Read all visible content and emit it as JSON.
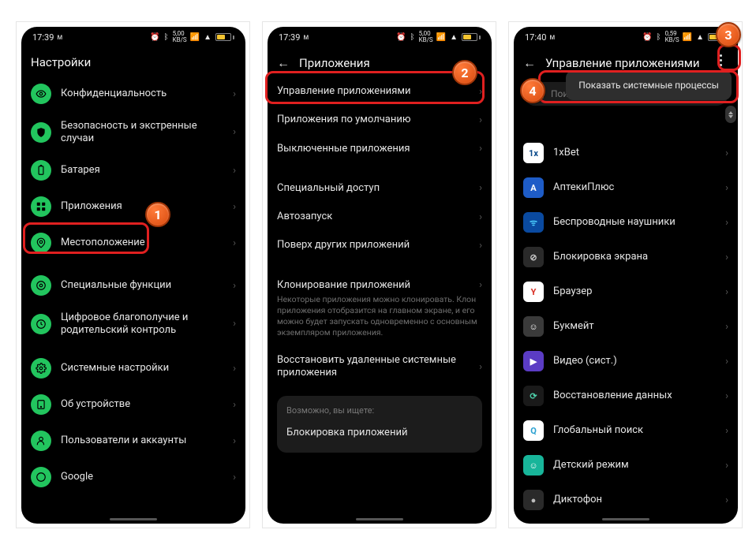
{
  "status": {
    "time1": "17:39",
    "time2": "17:39",
    "time3": "17:40",
    "net1": "5,00",
    "net2": "5,00",
    "net3": "0,59",
    "unit": "KB/S"
  },
  "screen1": {
    "title": "Настройки",
    "items": [
      "Конфиденциальность",
      "Безопасность и экстренные случаи",
      "Батарея",
      "Приложения",
      "Местоположение",
      "Специальные функции",
      "Цифровое благополучие и родительский контроль",
      "Системные настройки",
      "Об устройстве",
      "Пользователи и аккаунты",
      "Google"
    ]
  },
  "screen2": {
    "title": "Приложения",
    "group1": [
      "Управление приложениями",
      "Приложения по умолчанию",
      "Выключенные приложения"
    ],
    "group2": [
      "Специальный доступ",
      "Автозапуск",
      "Поверх других приложений"
    ],
    "cloneHead": "Клонирование приложений",
    "cloneDesc": "Некоторые приложения можно клонировать. Клон приложения отобразится на главном экране, и его можно будет запускать одновременно с основным экземпляром приложения.",
    "restore": "Восстановить удаленные системные приложения",
    "cardHint": "Возможно, вы ищете:",
    "cardItem": "Блокировка приложений"
  },
  "screen3": {
    "title": "Управление приложениями",
    "searchPlaceholder": "Поиск",
    "popup": "Показать системные процессы",
    "apps": [
      {
        "name": "1xBet",
        "bg": "#ffffff",
        "fg": "#0a4a8a",
        "glyph": "1x"
      },
      {
        "name": "АптекиПлюс",
        "bg": "#1e5cc7",
        "fg": "#ffffff",
        "glyph": "А"
      },
      {
        "name": "Беспроводные наушники",
        "bg": "#0a4aa0",
        "fg": "#4dd0ff",
        "glyph": "ᯤ"
      },
      {
        "name": "Блокировка экрана",
        "bg": "#2a2a2a",
        "fg": "#cccccc",
        "glyph": "⊘"
      },
      {
        "name": "Браузер",
        "bg": "#ffffff",
        "fg": "#d93025",
        "glyph": "Y"
      },
      {
        "name": "Букмейт",
        "bg": "#3a3a3a",
        "fg": "#ffffff",
        "glyph": "☺"
      },
      {
        "name": "Видео (сист.)",
        "bg": "#5b3cc4",
        "fg": "#ffffff",
        "glyph": "▶"
      },
      {
        "name": "Восстановление данных",
        "bg": "#1a1a1a",
        "fg": "#4dd0aa",
        "glyph": "⟳"
      },
      {
        "name": "Глобальный поиск",
        "bg": "#ffffff",
        "fg": "#2aa0d0",
        "glyph": "Q"
      },
      {
        "name": "Детский режим",
        "bg": "#18b59a",
        "fg": "#ffffff",
        "glyph": "☺"
      },
      {
        "name": "Диктофон",
        "bg": "#2a2a2a",
        "fg": "#bbbbbb",
        "glyph": "●"
      }
    ]
  }
}
